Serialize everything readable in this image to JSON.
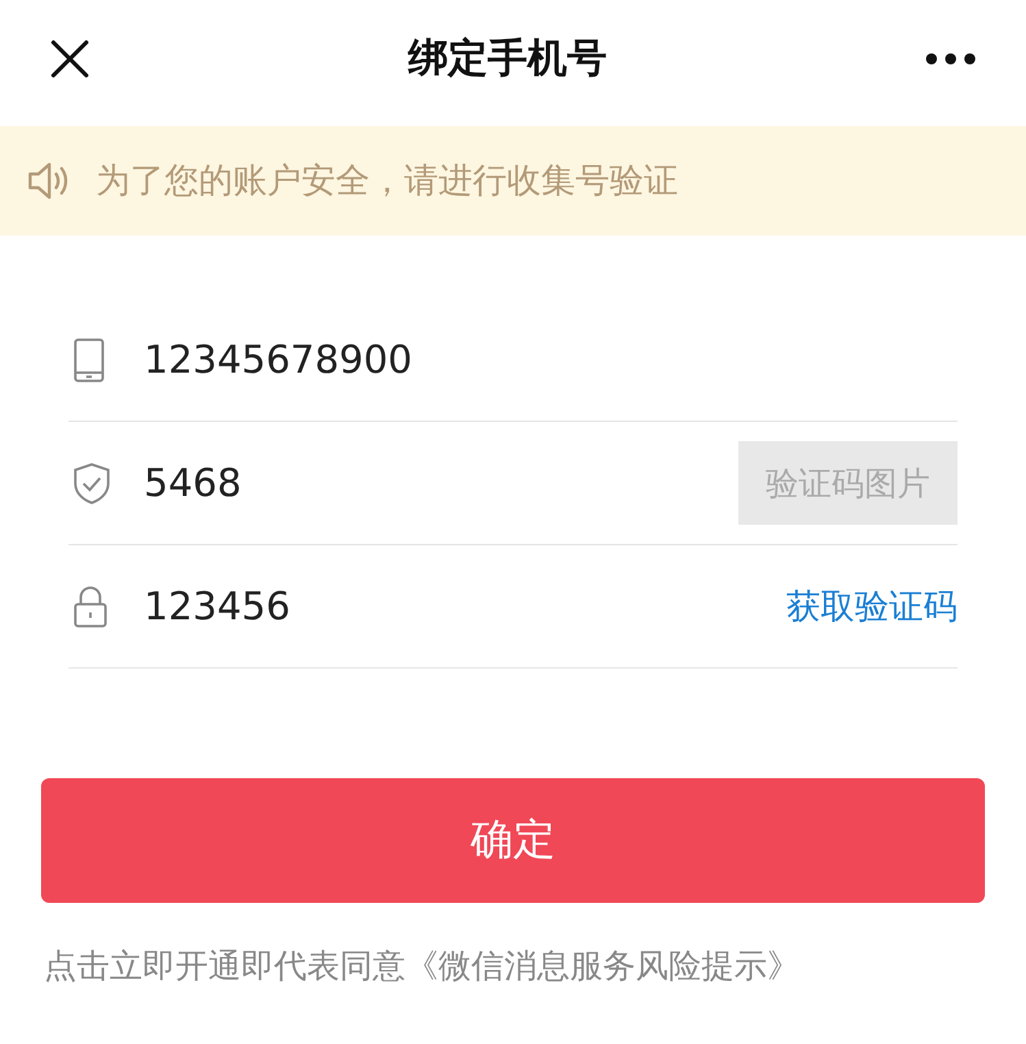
{
  "header": {
    "title": "绑定手机号"
  },
  "notice": {
    "text": "为了您的账户安全，请进行收集号验证"
  },
  "fields": [
    {
      "kind": "phone",
      "value": "12345678900"
    },
    {
      "kind": "captcha",
      "value": "5468",
      "action": "验证码图片"
    },
    {
      "kind": "sms",
      "value": "123456",
      "action": "获取验证码"
    }
  ],
  "confirm_button": "确定",
  "agreement": "点击立即开通即代表同意《微信消息服务风险提示》"
}
